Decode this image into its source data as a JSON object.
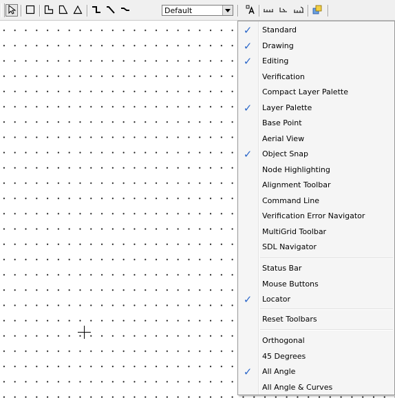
{
  "toolbar": {
    "layer_select_value": "Default",
    "buttons": [
      {
        "name": "select-arrow-icon"
      },
      {
        "name": "rectangle-icon"
      },
      {
        "name": "l-shape-icon"
      },
      {
        "name": "trapezoid-icon"
      },
      {
        "name": "triangle-icon"
      },
      {
        "name": "step-wire-icon"
      },
      {
        "name": "diagonal-wire-icon"
      },
      {
        "name": "straight-wire-icon"
      },
      {
        "name": "text-icon"
      },
      {
        "name": "ruler-icon"
      },
      {
        "name": "angle-dimension-icon"
      },
      {
        "name": "ruler-end-icon"
      },
      {
        "name": "layers-palette-icon"
      }
    ]
  },
  "menu": {
    "check_color": "#2b67c9",
    "items": [
      {
        "label": "Standard",
        "checked": true
      },
      {
        "label": "Drawing",
        "checked": true
      },
      {
        "label": "Editing",
        "checked": true
      },
      {
        "label": "Verification",
        "checked": false
      },
      {
        "label": "Compact Layer Palette",
        "checked": false
      },
      {
        "label": "Layer Palette",
        "checked": true
      },
      {
        "label": "Base Point",
        "checked": false
      },
      {
        "label": "Aerial View",
        "checked": false
      },
      {
        "label": "Object Snap",
        "checked": true
      },
      {
        "label": "Node Highlighting",
        "checked": false
      },
      {
        "label": "Alignment Toolbar",
        "checked": false
      },
      {
        "label": "Command Line",
        "checked": false
      },
      {
        "label": "Verification Error Navigator",
        "checked": false
      },
      {
        "label": "MultiGrid Toolbar",
        "checked": false
      },
      {
        "label": "SDL Navigator",
        "checked": false
      },
      {
        "label": "Status Bar",
        "checked": false
      },
      {
        "label": "Mouse Buttons",
        "checked": false
      },
      {
        "label": "Locator",
        "checked": true
      },
      {
        "label": "Reset Toolbars",
        "checked": false
      },
      {
        "label": "Orthogonal",
        "checked": false
      },
      {
        "label": "45 Degrees",
        "checked": false
      },
      {
        "label": "All Angle",
        "checked": true
      },
      {
        "label": "All Angle & Curves",
        "checked": false
      }
    ]
  }
}
